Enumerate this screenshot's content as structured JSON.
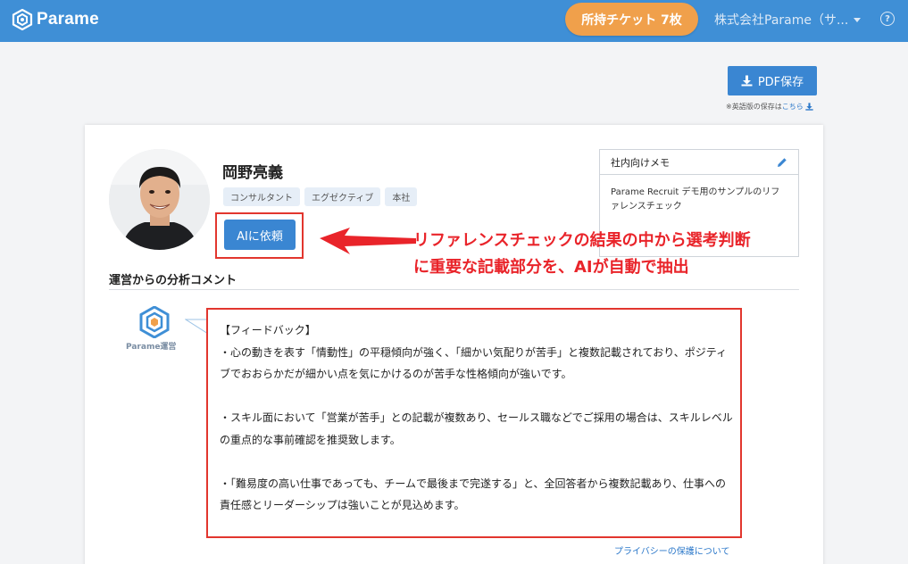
{
  "app": {
    "logo_text": "Parame"
  },
  "header": {
    "ticket_button": "所持チケット 7枚",
    "company_menu": "株式会社Parame（サ...",
    "help_icon": "?"
  },
  "pdf": {
    "button_label": "PDF保存",
    "note_prefix": "※英語版の保存は",
    "note_link": "こちら"
  },
  "profile": {
    "name": "岡野亮義",
    "tags": [
      "コンサルタント",
      "エグゼクティブ",
      "本社"
    ],
    "ai_button": "AIに依頼"
  },
  "memo": {
    "title": "社内向けメモ",
    "body": "Parame Recruit デモ用のサンプルのリファレンスチェック"
  },
  "annotation": {
    "line1": "リファレンスチェックの結果の中から選考判断",
    "line2": "に重要な記載部分を、AIが自動で抽出"
  },
  "analysis": {
    "section_title": "運営からの分析コメント",
    "author_label": "Parame運営",
    "feedback_heading": "【フィードバック】",
    "paragraphs": [
      "・心の動きを表す「情動性」の平穏傾向が強く、「細かい気配りが苦手」と複数記載されており、ポジティブでおおらかだが細かい点を気にかけるのが苦手な性格傾向が強いです。",
      "・スキル面において「営業が苦手」との記載が複数あり、セールス職などでご採用の場合は、スキルレベルの重点的な事前確認を推奨致します。",
      "・「難易度の高い仕事であっても、チームで最後まで完遂する」と、全回答者から複数記載あり、仕事への責任感とリーダーシップは強いことが見込めます。"
    ],
    "privacy_link": "プライバシーの保護について"
  },
  "colors": {
    "header_bg": "#3f8fd6",
    "ticket_orange": "#f0a04b",
    "primary_button": "#3a86d2",
    "highlight_red": "#e2362e"
  }
}
